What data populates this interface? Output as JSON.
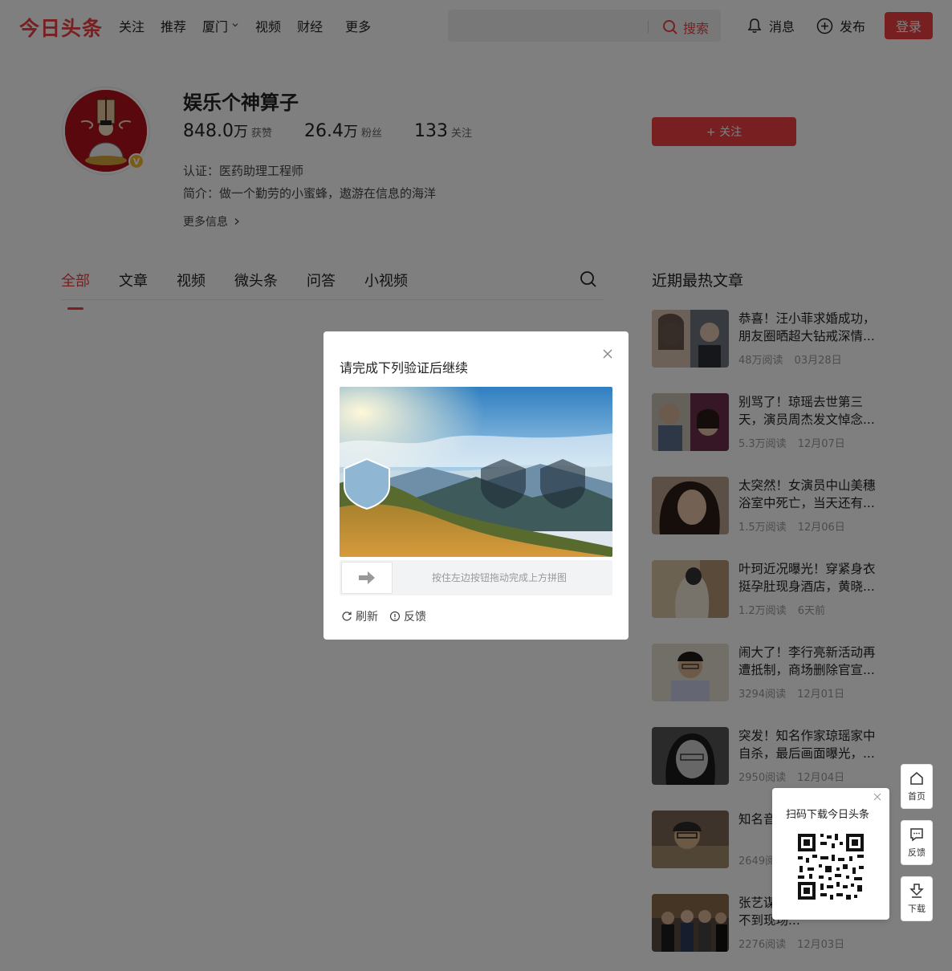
{
  "header": {
    "logo": "今日头条",
    "nav": [
      "关注",
      "推荐",
      "厦门",
      "视频",
      "财经",
      "更多"
    ],
    "search_placeholder": "",
    "search_button": "搜索",
    "messages": "消息",
    "publish": "发布",
    "login": "登录"
  },
  "profile": {
    "name": "娱乐个神算子",
    "stats": [
      {
        "num": "848.0",
        "unit": "万",
        "label": "获赞"
      },
      {
        "num": "26.4",
        "unit": "万",
        "label": "粉丝"
      },
      {
        "num": "133",
        "unit": "",
        "label": "关注"
      }
    ],
    "certification": "认证：医药助理工程师",
    "intro": "简介：做一个勤劳的小蜜蜂，遨游在信息的海洋",
    "more_info": "更多信息",
    "follow_button": "+ 关注",
    "verified_badge": "V"
  },
  "tabs": [
    "全部",
    "文章",
    "视频",
    "微头条",
    "问答",
    "小视频"
  ],
  "hot": {
    "title": "近期最热文章",
    "articles": [
      {
        "title": "恭喜！汪小菲求婚成功，朋友圈晒超大钻戒深情...",
        "reads": "48万阅读",
        "date": "03月28日"
      },
      {
        "title": "别骂了！琼瑶去世第三天，演员周杰发文悼念...",
        "reads": "5.3万阅读",
        "date": "12月07日"
      },
      {
        "title": "太突然！女演员中山美穗浴室中死亡，当天还有...",
        "reads": "1.5万阅读",
        "date": "12月06日"
      },
      {
        "title": "叶珂近况曝光！穿紧身衣挺孕肚现身酒店，黄晓...",
        "reads": "1.2万阅读",
        "date": "6天前"
      },
      {
        "title": "闹大了！李行亮新活动再遭抵制，商场删除官宣...",
        "reads": "3294阅读",
        "date": "12月01日"
      },
      {
        "title": "突发！知名作家琼瑶家中自杀，最后画面曝光，...",
        "reads": "2950阅读",
        "date": "12月04日"
      },
      {
        "title": "知名音乐人晚年生活...",
        "reads": "2649阅读",
        "date": ""
      },
      {
        "title": "张艺谋现身聚会，跟着想不到现场...",
        "reads": "2276阅读",
        "date": "12月03日"
      }
    ]
  },
  "captcha": {
    "title": "请完成下列验证后继续",
    "hint": "按住左边按钮拖动完成上方拼图",
    "refresh": "刷新",
    "feedback": "反馈"
  },
  "qr": {
    "title": "扫码下载今日头条"
  },
  "rail": {
    "home": "首页",
    "feedback": "反馈",
    "download": "下载"
  },
  "colors": {
    "brand": "#f04142",
    "avatar_bg": "#b3121c"
  }
}
